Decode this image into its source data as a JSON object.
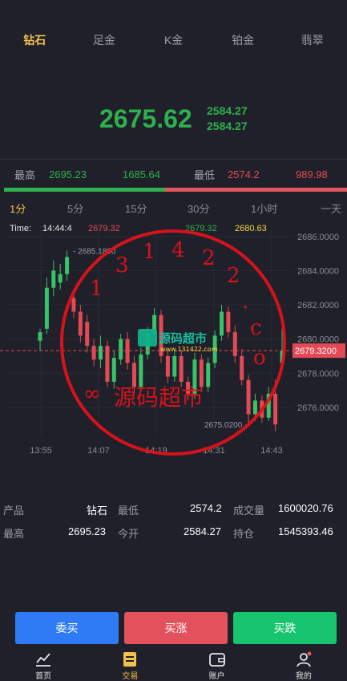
{
  "tabs": [
    "钻石",
    "足金",
    "K金",
    "铂金",
    "翡翠"
  ],
  "price": {
    "current": "2675.62",
    "line1": "2584.27",
    "line2": "2584.27"
  },
  "stats": {
    "high_label": "最高",
    "high_value": "2695.23",
    "high_qty": "1685.64",
    "low_label": "最低",
    "low_value": "2574.2",
    "low_qty": "989.98"
  },
  "buy_ratio": 0.47,
  "periods": [
    "1分",
    "5分",
    "15分",
    "30分",
    "1小时",
    "一天"
  ],
  "chart_header": {
    "time_label": "Time:",
    "time": "14:44:4",
    "v1": "2679.32",
    "v2": "2679.32",
    "v3": "2680.63"
  },
  "chart_data": {
    "type": "candlestick",
    "y_ticks": [
      "2686.0000",
      "2684.0000",
      "2682.0000",
      "2680.0000",
      "2678.0000",
      "2676.0000"
    ],
    "x_ticks": [
      "13:55",
      "14:07",
      "14:19",
      "14:31",
      "14:43"
    ],
    "current_price": "2679.3200",
    "max_label": "2685.1800",
    "min_label": "2675.0200",
    "ylim": [
      2674.4,
      2686.6
    ],
    "candles": [
      {
        "o": 2679.9,
        "c": 2680.4,
        "h": 2680.6,
        "l": 2679.3
      },
      {
        "o": 2680.6,
        "c": 2683.0,
        "h": 2683.6,
        "l": 2680.3
      },
      {
        "o": 2683.0,
        "c": 2684.0,
        "h": 2684.6,
        "l": 2682.5
      },
      {
        "o": 2683.3,
        "c": 2683.8,
        "h": 2684.4,
        "l": 2682.9
      },
      {
        "o": 2683.8,
        "c": 2684.8,
        "h": 2685.18,
        "l": 2683.4
      },
      {
        "o": 2682.4,
        "c": 2681.6,
        "h": 2682.7,
        "l": 2681.2
      },
      {
        "o": 2681.6,
        "c": 2680.2,
        "h": 2682.0,
        "l": 2679.8
      },
      {
        "o": 2681.0,
        "c": 2679.6,
        "h": 2681.4,
        "l": 2679.2
      },
      {
        "o": 2679.6,
        "c": 2678.8,
        "h": 2680.0,
        "l": 2678.4
      },
      {
        "o": 2678.8,
        "c": 2679.6,
        "h": 2680.2,
        "l": 2678.3
      },
      {
        "o": 2679.6,
        "c": 2677.5,
        "h": 2679.9,
        "l": 2677.2
      },
      {
        "o": 2677.5,
        "c": 2678.9,
        "h": 2679.3,
        "l": 2677.1
      },
      {
        "o": 2678.8,
        "c": 2680.0,
        "h": 2680.3,
        "l": 2678.5
      },
      {
        "o": 2680.0,
        "c": 2678.6,
        "h": 2680.4,
        "l": 2678.2
      },
      {
        "o": 2678.6,
        "c": 2677.2,
        "h": 2679.0,
        "l": 2676.8
      },
      {
        "o": 2677.2,
        "c": 2679.1,
        "h": 2679.5,
        "l": 2676.9
      },
      {
        "o": 2679.1,
        "c": 2680.3,
        "h": 2680.7,
        "l": 2678.8
      },
      {
        "o": 2680.3,
        "c": 2681.4,
        "h": 2681.8,
        "l": 2680.0
      },
      {
        "o": 2681.4,
        "c": 2679.0,
        "h": 2681.7,
        "l": 2678.6
      },
      {
        "o": 2679.0,
        "c": 2677.8,
        "h": 2679.3,
        "l": 2677.4
      },
      {
        "o": 2677.8,
        "c": 2679.0,
        "h": 2679.3,
        "l": 2677.5
      },
      {
        "o": 2679.0,
        "c": 2677.5,
        "h": 2679.3,
        "l": 2677.2
      },
      {
        "o": 2677.5,
        "c": 2676.8,
        "h": 2677.8,
        "l": 2676.4
      },
      {
        "o": 2676.8,
        "c": 2678.8,
        "h": 2679.2,
        "l": 2676.5
      },
      {
        "o": 2678.8,
        "c": 2677.2,
        "h": 2679.1,
        "l": 2676.9
      },
      {
        "o": 2677.2,
        "c": 2678.6,
        "h": 2678.9,
        "l": 2676.9
      },
      {
        "o": 2678.6,
        "c": 2680.2,
        "h": 2680.5,
        "l": 2678.3
      },
      {
        "o": 2680.2,
        "c": 2681.6,
        "h": 2682.0,
        "l": 2679.9
      },
      {
        "o": 2681.6,
        "c": 2680.4,
        "h": 2681.9,
        "l": 2680.1
      },
      {
        "o": 2680.4,
        "c": 2679.0,
        "h": 2680.8,
        "l": 2678.6
      },
      {
        "o": 2679.0,
        "c": 2677.6,
        "h": 2679.4,
        "l": 2677.3
      },
      {
        "o": 2677.6,
        "c": 2675.6,
        "h": 2677.9,
        "l": 2675.02
      },
      {
        "o": 2675.6,
        "c": 2676.4,
        "h": 2676.8,
        "l": 2675.2
      },
      {
        "o": 2676.4,
        "c": 2675.4,
        "h": 2676.7,
        "l": 2675.1
      },
      {
        "o": 2675.4,
        "c": 2676.8,
        "h": 2677.2,
        "l": 2675.2
      },
      {
        "o": 2676.8,
        "c": 2675.0,
        "h": 2677.6,
        "l": 2674.6
      },
      {
        "o": 2678.6,
        "c": 2679.3,
        "h": 2680.6,
        "l": 2678.3
      }
    ]
  },
  "info": {
    "row1": [
      "产品",
      "钻石",
      "最低",
      "2574.2",
      "成交量",
      "1600020.76"
    ],
    "row2": [
      "最高",
      "2695.23",
      "今开",
      "2584.27",
      "持仓",
      "1545393.46"
    ]
  },
  "buttons": {
    "entrust": "委买",
    "up": "买涨",
    "down": "买跌"
  },
  "colors": {
    "entrust": "#2f7bf6",
    "up": "#e3525c",
    "down": "#16c56e"
  },
  "nav": [
    {
      "label": "首页",
      "icon": "chart-icon"
    },
    {
      "label": "交易",
      "icon": "trade-icon"
    },
    {
      "label": "账户",
      "icon": "wallet-icon"
    },
    {
      "label": "我的",
      "icon": "user-icon"
    }
  ],
  "watermark": {
    "ring": "1 3 1 4 2 2 . c o m",
    "text": "源码超市",
    "logo": "源码超市",
    "url": "www.131422.com"
  }
}
